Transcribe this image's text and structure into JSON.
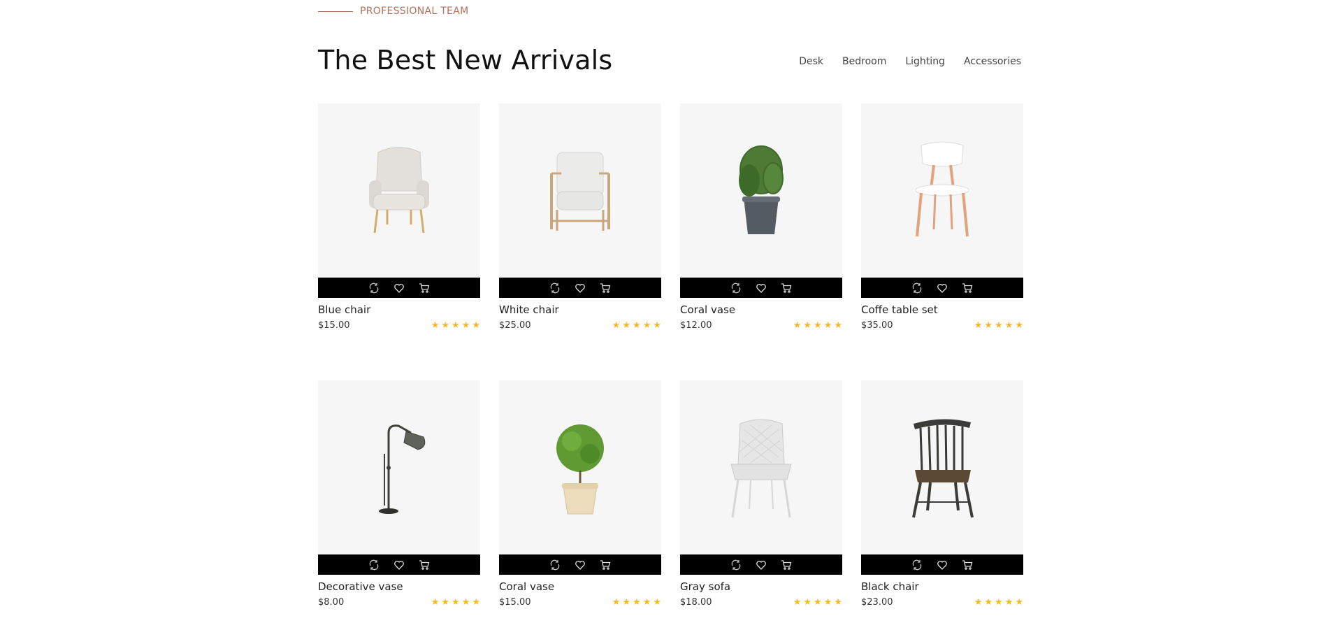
{
  "eyebrow": "PROFESSIONAL TEAM",
  "title": "The Best New Arrivals",
  "filters": [
    "Desk",
    "Bedroom",
    "Lighting",
    "Accessories"
  ],
  "colors": {
    "accent": "#b3705a",
    "star": "#f5b921",
    "actionbar": "#000000",
    "card_bg": "#f6f6f6"
  },
  "products": [
    {
      "name": "Blue chair",
      "price": "$15.00",
      "rating": 5,
      "icon": "armchair-beige"
    },
    {
      "name": "White chair",
      "price": "$25.00",
      "rating": 5,
      "icon": "armchair-wood"
    },
    {
      "name": "Coral vase",
      "price": "$12.00",
      "rating": 5,
      "icon": "potted-plant"
    },
    {
      "name": "Coffe table set",
      "price": "$35.00",
      "rating": 5,
      "icon": "dining-chair"
    },
    {
      "name": "Decorative vase",
      "price": "$8.00",
      "rating": 5,
      "icon": "floor-lamp"
    },
    {
      "name": "Coral vase",
      "price": "$15.00",
      "rating": 5,
      "icon": "topiary-plant"
    },
    {
      "name": "Gray sofa",
      "price": "$18.00",
      "rating": 5,
      "icon": "quilted-chair"
    },
    {
      "name": "Black chair",
      "price": "$23.00",
      "rating": 5,
      "icon": "spindle-chair"
    }
  ],
  "actions": [
    "compare-icon",
    "heart-icon",
    "cart-icon"
  ]
}
